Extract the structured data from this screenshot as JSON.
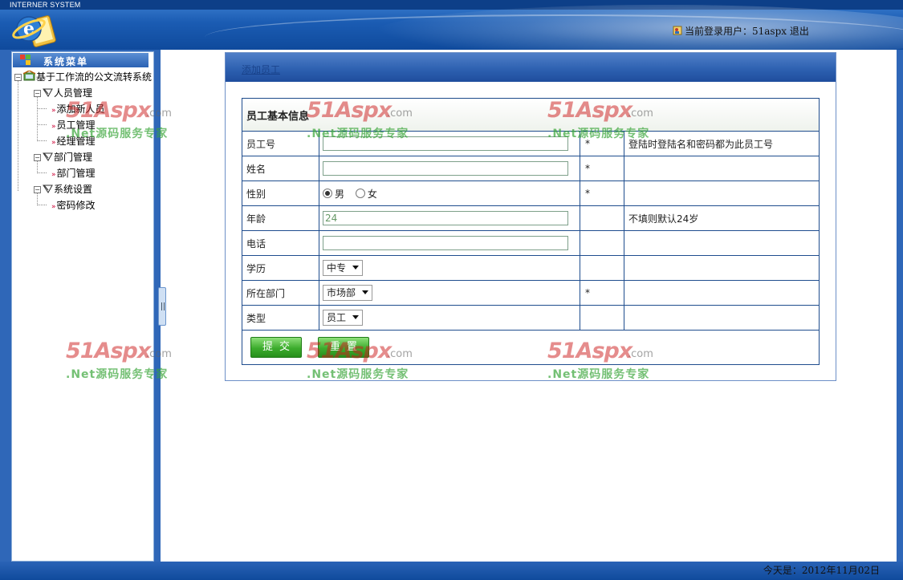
{
  "window": {
    "system_title": "INTERNER SYSTEM"
  },
  "header": {
    "login_text": "当前登录用户：51aspx",
    "logout_label": "退出"
  },
  "menu": {
    "title": "系统菜单",
    "root": "基于工作流的公文流转系统",
    "groups": [
      {
        "label": "人员管理",
        "items": [
          "添加新人员",
          "员工管理",
          "经理管理"
        ]
      },
      {
        "label": "部门管理",
        "items": [
          "部门管理"
        ]
      },
      {
        "label": "系统设置",
        "items": [
          "密码修改"
        ]
      }
    ]
  },
  "panel": {
    "title": "添加员工",
    "section_title": "员工基本信息",
    "rows": {
      "emp_id": {
        "label": "员工号",
        "value": "",
        "req": "*",
        "note": "登陆时登陆名和密码都为此员工号"
      },
      "name": {
        "label": "姓名",
        "value": "",
        "req": "*",
        "note": ""
      },
      "gender": {
        "label": "性别",
        "options": [
          "男",
          "女"
        ],
        "selected": "男",
        "req": "*"
      },
      "age": {
        "label": "年龄",
        "value": "24",
        "note": "不填则默认24岁"
      },
      "phone": {
        "label": "电话",
        "value": ""
      },
      "education": {
        "label": "学历",
        "value": "中专"
      },
      "department": {
        "label": "所在部门",
        "value": "市场部",
        "req": "*"
      },
      "type": {
        "label": "类型",
        "value": "员工"
      }
    },
    "submit_label": "提交",
    "reset_label": "重置"
  },
  "footer": {
    "date_text": "今天是：2012年11月02日"
  },
  "watermark": {
    "brand": "51Aspx",
    "domain": ".com",
    "tagline": ".Net源码服务专家"
  },
  "colors": {
    "header_blue": "#1b5cb3",
    "table_border": "#1f4d8e",
    "button_green": "#3cac2d",
    "watermark_red": "#cc1b1b",
    "watermark_green": "#3aa63a"
  }
}
